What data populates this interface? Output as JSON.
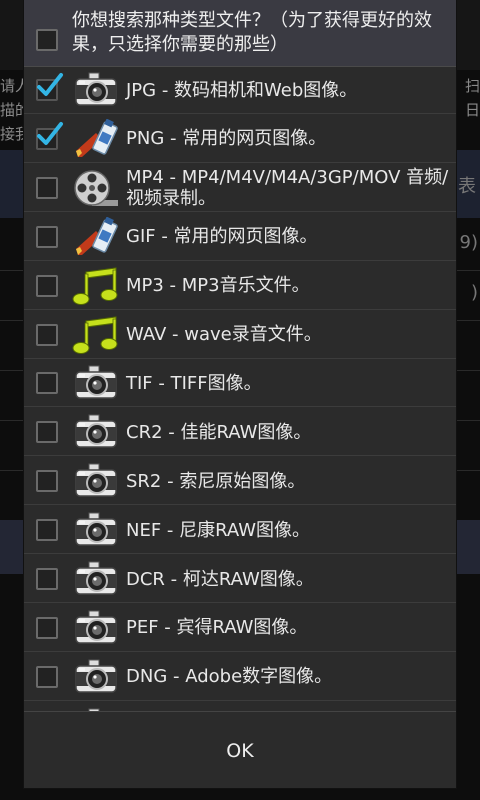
{
  "background": {
    "left_lines": [
      "请人",
      "描的",
      "接我"
    ],
    "right_lines": [
      "扫",
      "日"
    ],
    "tab_hint": "表",
    "row_fragments": [
      "9)",
      ")"
    ]
  },
  "dialog": {
    "title": "你想搜索那种类型文件？（为了获得更好的效果，只选择你需要的那些）",
    "ok_label": "OK",
    "items": [
      {
        "label": "JPG - 数码相机和Web图像。",
        "checked": true,
        "icon": "camera-icon"
      },
      {
        "label": "PNG - 常用的网页图像。",
        "checked": true,
        "icon": "paint-tube-icon"
      },
      {
        "label": "MP4 - MP4/M4V/M4A/3GP/MOV 音频/视频录制。",
        "checked": false,
        "icon": "film-reel-icon"
      },
      {
        "label": "GIF - 常用的网页图像。",
        "checked": false,
        "icon": "paint-tube-icon"
      },
      {
        "label": "MP3 - MP3音乐文件。",
        "checked": false,
        "icon": "music-note-icon"
      },
      {
        "label": "WAV - wave录音文件。",
        "checked": false,
        "icon": "music-note-icon"
      },
      {
        "label": "TIF - TIFF图像。",
        "checked": false,
        "icon": "camera-icon"
      },
      {
        "label": "CR2 - 佳能RAW图像。",
        "checked": false,
        "icon": "camera-icon"
      },
      {
        "label": "SR2 - 索尼原始图像。",
        "checked": false,
        "icon": "camera-icon"
      },
      {
        "label": "NEF - 尼康RAW图像。",
        "checked": false,
        "icon": "camera-icon"
      },
      {
        "label": "DCR - 柯达RAW图像。",
        "checked": false,
        "icon": "camera-icon"
      },
      {
        "label": "PEF - 宾得RAW图像。",
        "checked": false,
        "icon": "camera-icon"
      },
      {
        "label": "DNG - Adobe数字图像。",
        "checked": false,
        "icon": "camera-icon"
      }
    ]
  },
  "colors": {
    "check_accent": "#33b5e5",
    "note_green": "#c6e01c"
  }
}
